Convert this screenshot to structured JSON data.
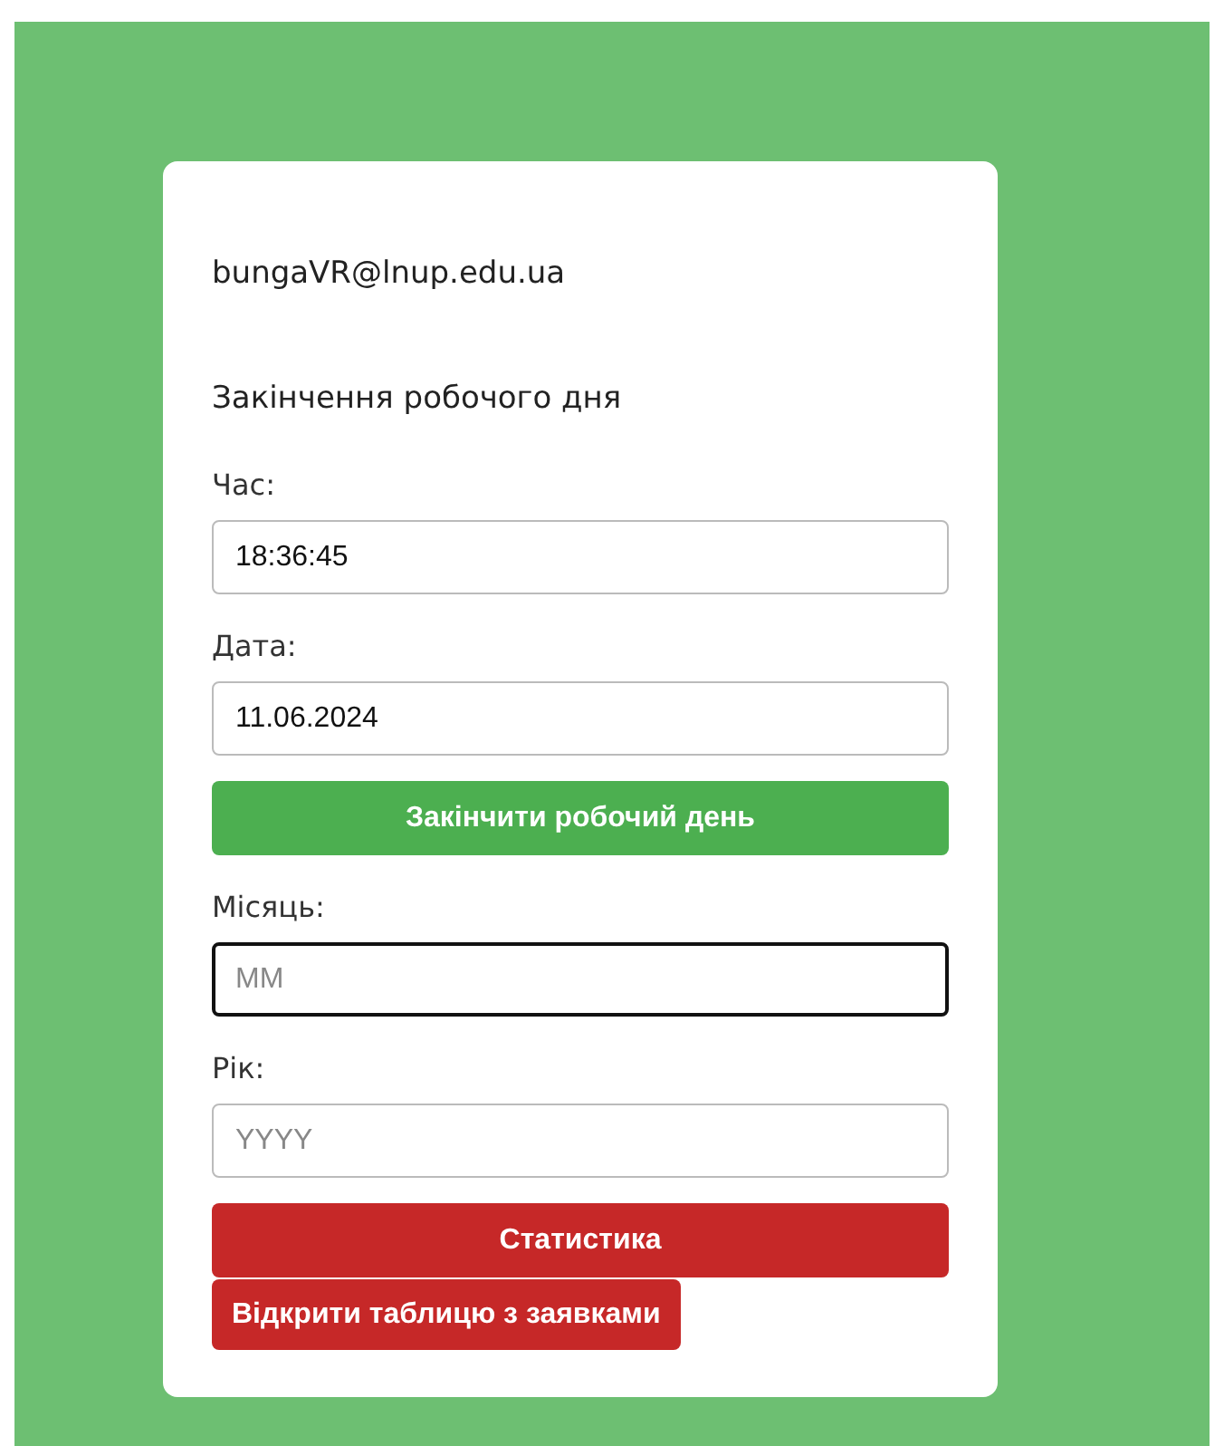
{
  "user_email": "bungaVR@lnup.edu.ua",
  "section_title": "Закінчення робочого дня",
  "items": [
    {
      "kind": "field",
      "label": "Час:",
      "value": "18:36:45",
      "focused": false
    },
    {
      "kind": "field",
      "label": "Дата:",
      "value": "11.06.2024",
      "focused": false
    },
    {
      "kind": "button",
      "label": "Закінчити робочий день",
      "color": "#4caf50",
      "full_width": true
    },
    {
      "kind": "field",
      "label": "Місяць:",
      "placeholder": "MM",
      "focused": true
    },
    {
      "kind": "field",
      "label": "Рік:",
      "placeholder": "YYYY",
      "focused": false
    },
    {
      "kind": "button",
      "label": "Статистика",
      "color": "#c62828",
      "full_width": true
    },
    {
      "kind": "button",
      "label": "Відкрити таблицю з заявками",
      "color": "#c62828",
      "full_width": false
    }
  ]
}
